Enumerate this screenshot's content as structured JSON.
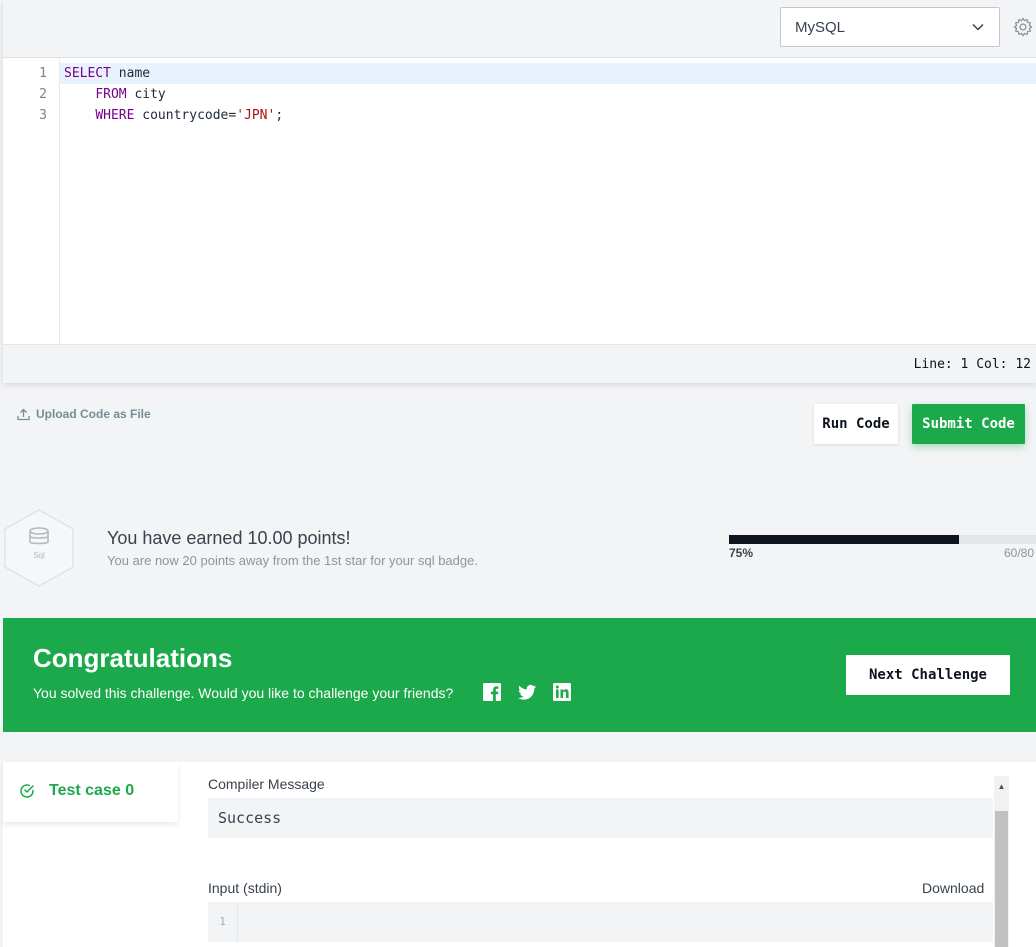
{
  "editor": {
    "language": "MySQL",
    "line_numbers": [
      "1",
      "2",
      "3"
    ],
    "lines": [
      {
        "kw": "SELECT",
        "rest": " name"
      },
      {
        "indent": "    ",
        "kw": "FROM",
        "rest": " city"
      },
      {
        "indent": "    ",
        "kw": "WHERE",
        "rest": " countrycode=",
        "str": "'JPN'",
        "tail": ";"
      }
    ],
    "status": "Line: 1 Col: 12"
  },
  "actions": {
    "upload_label": "Upload Code as File",
    "run_label": "Run Code",
    "submit_label": "Submit Code"
  },
  "points": {
    "badge_label": "Sql",
    "earned_text": "You have earned 10.00 points!",
    "sub_text": "You are now 20 points away from the 1st star for your sql badge.",
    "progress_percent_label": "75%",
    "progress_fraction": 0.75,
    "progress_count": "60/80"
  },
  "congrats": {
    "title": "Congratulations",
    "message": "You solved this challenge. Would you like to challenge your friends?",
    "next_label": "Next Challenge"
  },
  "results": {
    "tab_label": "Test case 0",
    "compiler_label": "Compiler Message",
    "compiler_value": "Success",
    "input_label": "Input (stdin)",
    "download_label": "Download",
    "stdin_line": "1"
  },
  "colors": {
    "accent_green": "#1ba94c",
    "dark": "#0e141e"
  },
  "icons": [
    "chevron-down-icon",
    "gear-icon",
    "upload-icon",
    "database-icon",
    "facebook-icon",
    "twitter-icon",
    "linkedin-icon",
    "check-circle-icon"
  ]
}
